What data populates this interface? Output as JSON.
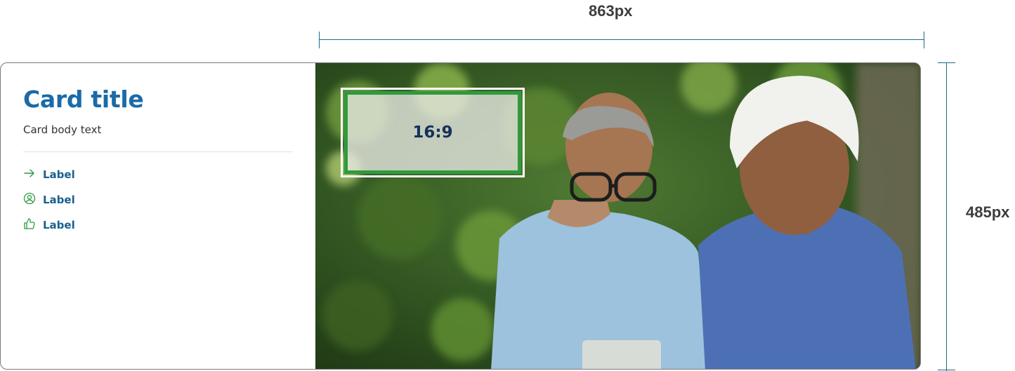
{
  "dimensions": {
    "width_label": "863px",
    "height_label": "485px"
  },
  "card": {
    "title": "Card title",
    "body_text": "Card body text",
    "links": [
      {
        "icon": "arrow-right-icon",
        "label": "Label"
      },
      {
        "icon": "user-circle-icon",
        "label": "Label"
      },
      {
        "icon": "thumbs-up-icon",
        "label": "Label"
      }
    ],
    "media": {
      "ratio_label": "16:9"
    }
  },
  "colors": {
    "title": "#1a6ba8",
    "link_text": "#1a5f8f",
    "icon": "#2e9a3e",
    "ratio_border": "#2e9a3e",
    "dimension_lines": "#1b6b8a"
  }
}
